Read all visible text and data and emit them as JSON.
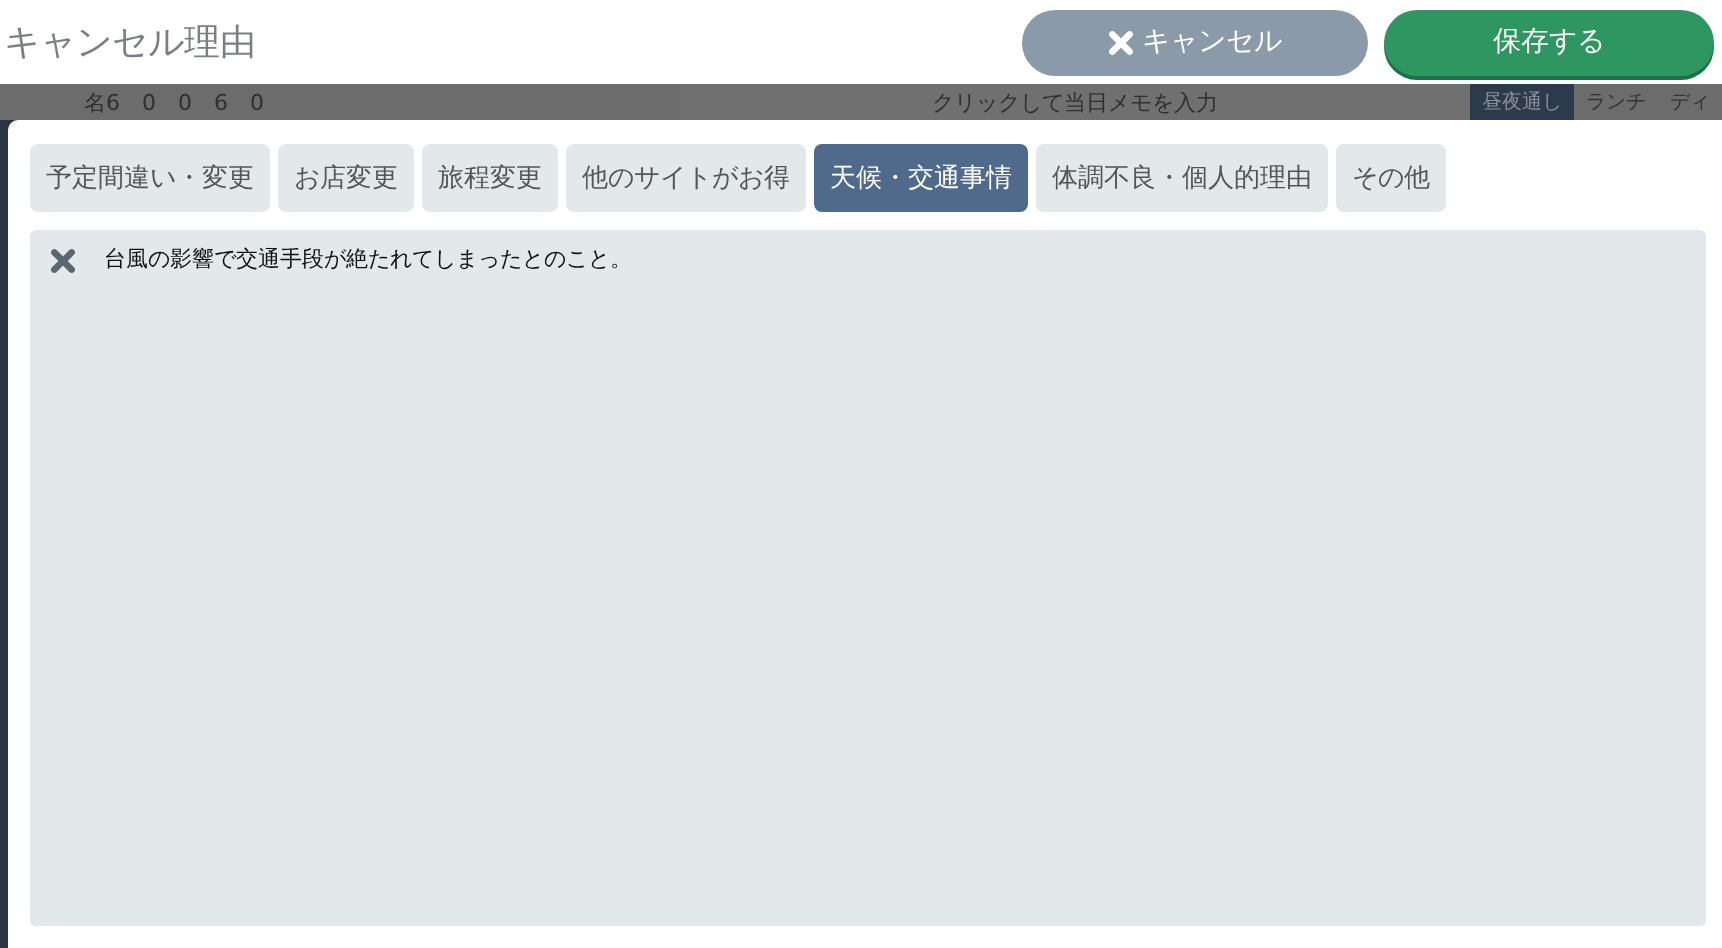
{
  "header": {
    "title": "キャンセル理由",
    "buttons": [
      {
        "kind": "cancel",
        "label": "キャンセル"
      },
      {
        "kind": "save",
        "label": "保存する"
      }
    ]
  },
  "background": {
    "counts": "名6　0　0　6　0",
    "memo_placeholder": "クリックして当日メモを入力",
    "tabs": [
      {
        "label": "昼夜通し",
        "selected": true
      },
      {
        "label": "ランチ",
        "selected": false
      },
      {
        "label": "ディ",
        "selected": false
      }
    ]
  },
  "reasons": [
    {
      "label": "予定間違い・変更",
      "selected": false
    },
    {
      "label": "お店変更",
      "selected": false
    },
    {
      "label": "旅程変更",
      "selected": false
    },
    {
      "label": "他のサイトがお得",
      "selected": false
    },
    {
      "label": "天候・交通事情",
      "selected": true
    },
    {
      "label": "体調不良・個人的理由",
      "selected": false
    },
    {
      "label": "その他",
      "selected": false
    }
  ],
  "note": {
    "value": "台風の影響で交通手段が絶たれてしまったとのこと。"
  }
}
